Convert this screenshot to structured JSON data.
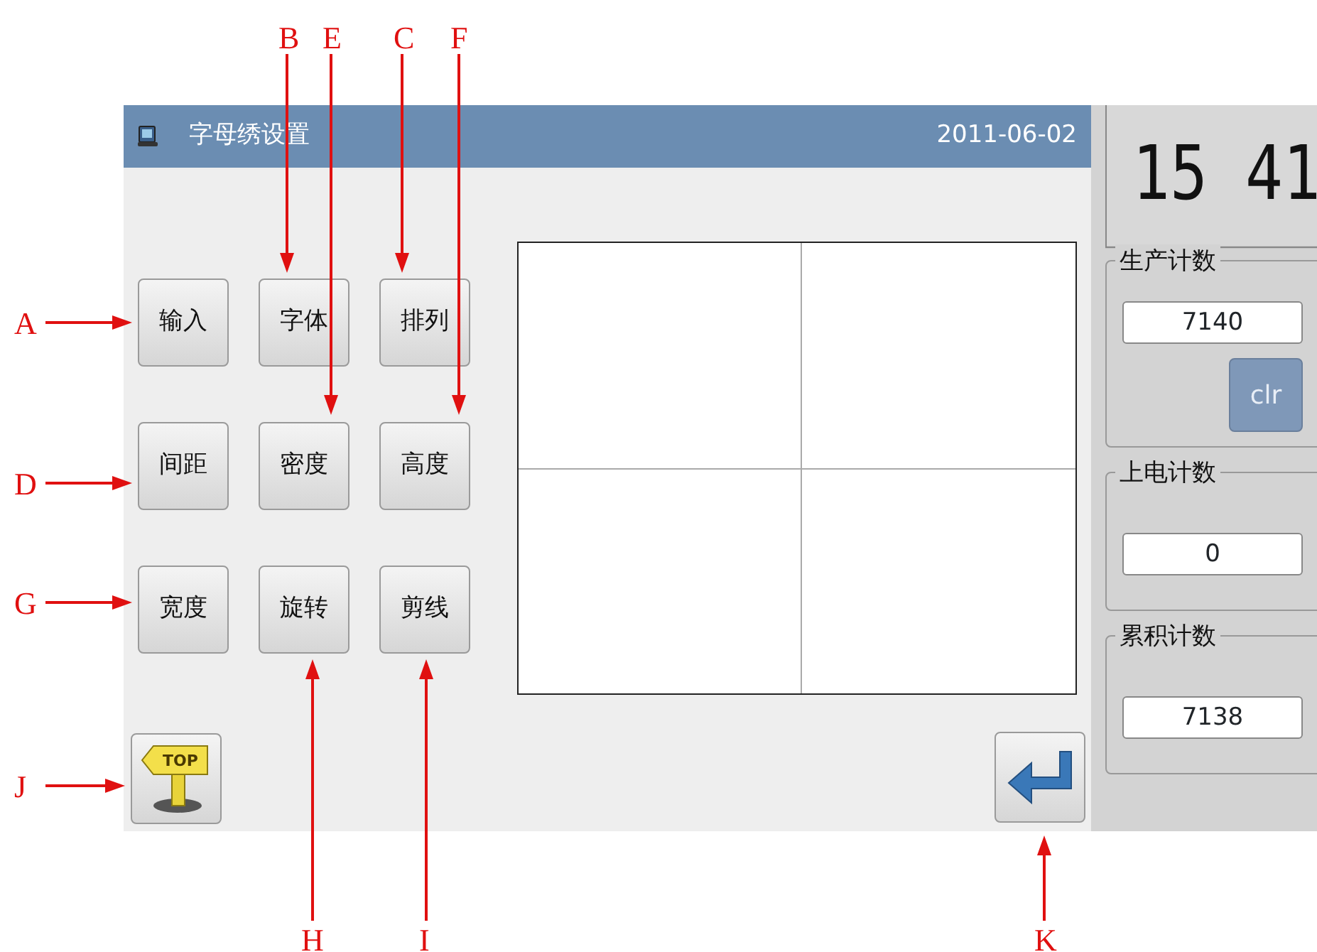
{
  "window": {
    "title": "字母绣设置",
    "date": "2011-06-02"
  },
  "buttons": [
    {
      "label": "输入"
    },
    {
      "label": "字体"
    },
    {
      "label": "排列"
    },
    {
      "label": "间距"
    },
    {
      "label": "密度"
    },
    {
      "label": "高度"
    },
    {
      "label": "宽度"
    },
    {
      "label": "旋转"
    },
    {
      "label": "剪线"
    }
  ],
  "top_button": {
    "sign_text": "TOP"
  },
  "clock": {
    "display": "15 41"
  },
  "counters": [
    {
      "label": "生产计数",
      "value": "7140",
      "clear_button": "clr"
    },
    {
      "label": "上电计数",
      "value": "0"
    },
    {
      "label": "累积计数",
      "value": "7138"
    }
  ],
  "callouts": [
    {
      "label": "B"
    },
    {
      "label": "E"
    },
    {
      "label": "C"
    },
    {
      "label": "F"
    },
    {
      "label": "A"
    },
    {
      "label": "D"
    },
    {
      "label": "G"
    },
    {
      "label": "J"
    },
    {
      "label": "H"
    },
    {
      "label": "I"
    },
    {
      "label": "K"
    }
  ]
}
